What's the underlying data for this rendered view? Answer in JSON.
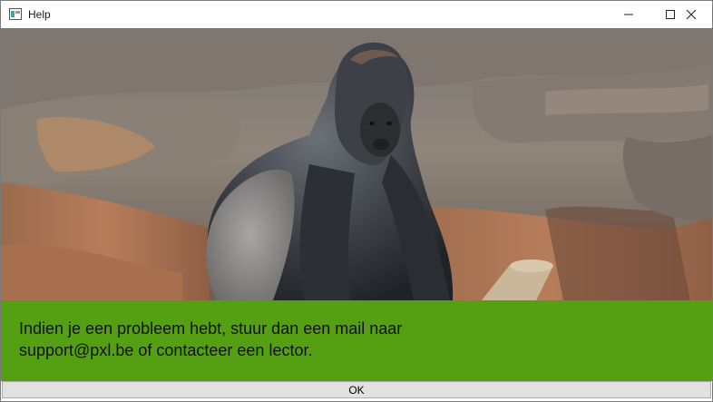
{
  "window": {
    "title": "Help",
    "app_icon": "window-app-icon",
    "controls": {
      "minimize_icon": "minimize-icon",
      "maximize_icon": "maximize-icon",
      "close_icon": "close-icon"
    }
  },
  "content": {
    "image_subject": "gorilla",
    "message_line1": "Indien je een probleem hebt, stuur dan een mail naar",
    "message_line2": "support@pxl.be of contacteer een lector.",
    "panel_color": "#55a012"
  },
  "footer": {
    "ok_label": "OK"
  }
}
